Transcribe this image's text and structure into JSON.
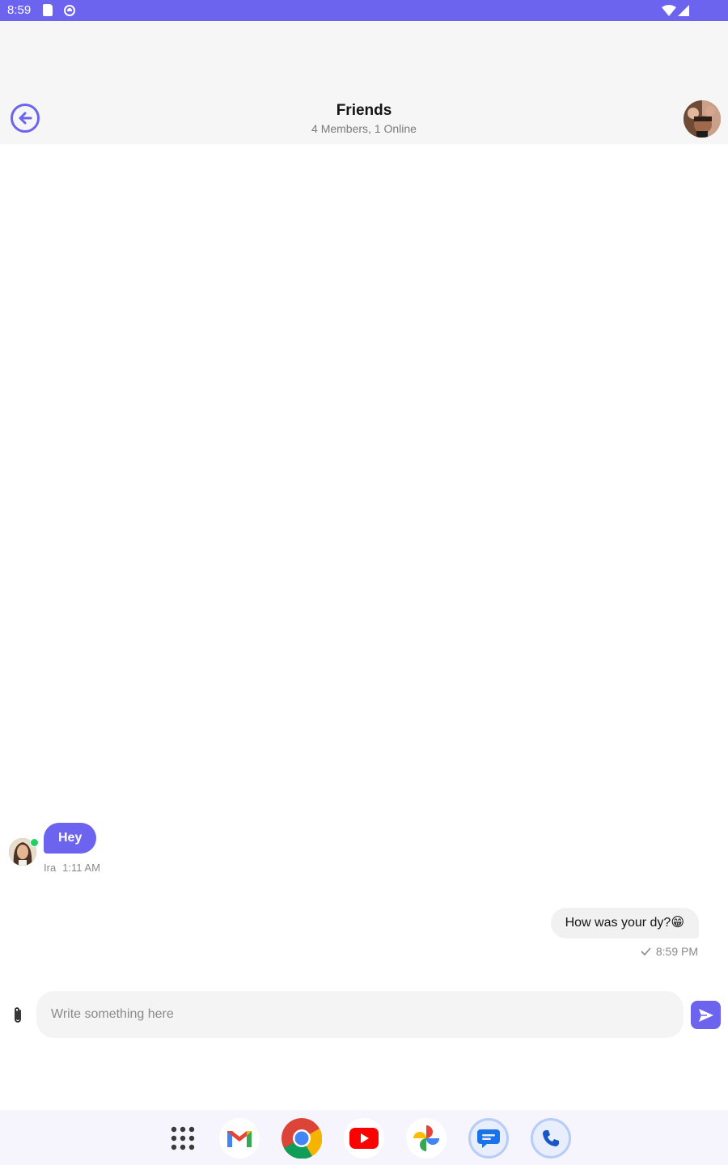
{
  "status_bar": {
    "time": "8:59"
  },
  "header": {
    "title": "Friends",
    "subtitle": "4 Members, 1 Online"
  },
  "messages": [
    {
      "direction": "incoming",
      "text": "Hey",
      "sender": "Ira",
      "time": "1:11 AM",
      "online": true
    },
    {
      "direction": "outgoing",
      "text": "How was your dy?😁",
      "time": "8:59 PM",
      "status": "sent"
    }
  ],
  "composer": {
    "placeholder": "Write something here"
  },
  "dock": {
    "apps": [
      "app-drawer",
      "gmail",
      "chrome",
      "youtube",
      "photos",
      "messages",
      "phone"
    ]
  },
  "colors": {
    "accent": "#6c63ef",
    "header_bg": "#f6f6f6",
    "outgoing_bubble": "#f1f1f1",
    "online": "#1fd160"
  }
}
